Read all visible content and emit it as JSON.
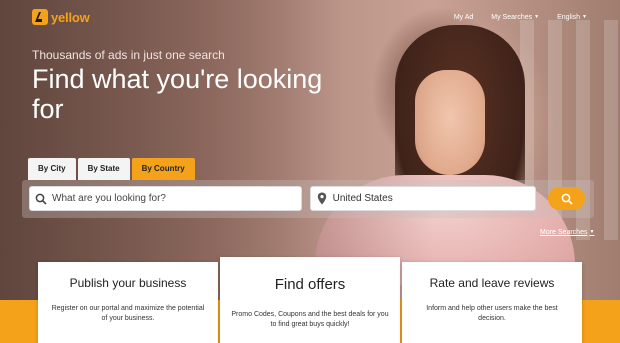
{
  "brand": {
    "logo_text": "yellow",
    "accent": "#f5a21b"
  },
  "nav": {
    "my_ad": "My Ad",
    "my_searches": "My Searches",
    "language": "English"
  },
  "hero": {
    "tagline": "Thousands of ads in just one search",
    "headline": "Find what you're looking for"
  },
  "tabs": [
    {
      "label": "By City",
      "active": false
    },
    {
      "label": "By State",
      "active": false
    },
    {
      "label": "By Country",
      "active": true
    }
  ],
  "search": {
    "what_placeholder": "What are you looking for?",
    "location_value": "United States",
    "more_searches": "More Searches"
  },
  "cards": [
    {
      "title": "Publish your business",
      "text": "Register on our portal and maximize the potential of your business."
    },
    {
      "title": "Find offers",
      "text": "Promo Codes, Coupons and the best deals for you to find great buys quickly!"
    },
    {
      "title": "Rate and leave reviews",
      "text": "Inform and help other users make the best decision."
    }
  ],
  "icons": {
    "search": "search-icon",
    "location": "location-pin-icon",
    "caret": "chevron-down-icon"
  }
}
